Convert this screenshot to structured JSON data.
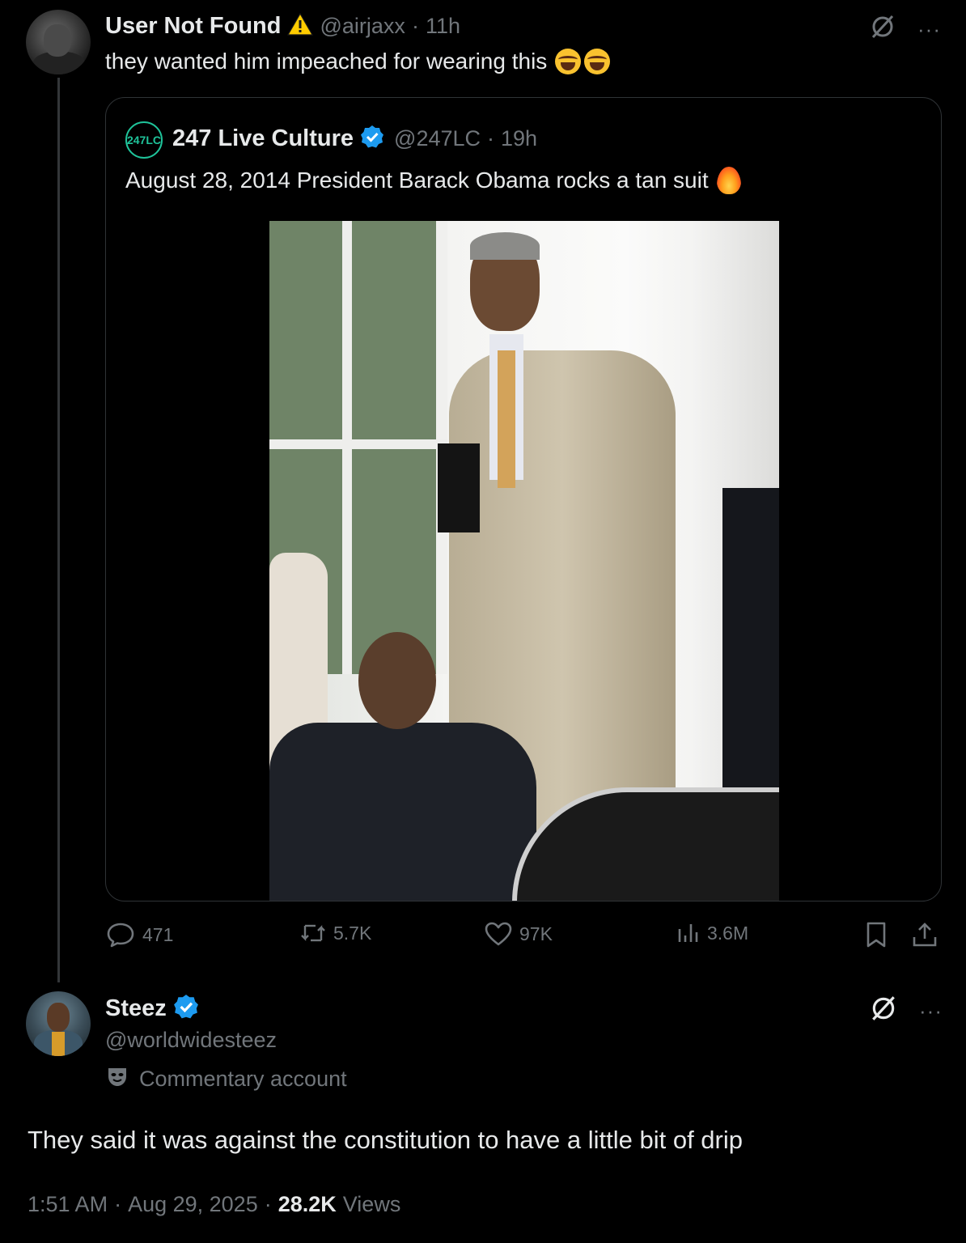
{
  "original_post": {
    "display_name": "User Not Found",
    "handle": "@airjaxx",
    "separator": "·",
    "time": "11h",
    "text": "they wanted him impeached for wearing this",
    "emojis": [
      "face-with-tears-of-joy",
      "face-with-tears-of-joy"
    ],
    "more_label": "···"
  },
  "quoted_post": {
    "logo_text": "247LC",
    "display_name": "247 Live Culture",
    "handle": "@247LC",
    "separator": "·",
    "time": "19h",
    "text": "August 28, 2014 President Barack Obama rocks a tan suit",
    "emoji": "fire"
  },
  "actions": {
    "replies": "471",
    "reposts": "5.7K",
    "likes": "97K",
    "views": "3.6M"
  },
  "reply_post": {
    "display_name": "Steez",
    "handle": "@worldwidesteez",
    "label": "Commentary account",
    "text": "They said it was against the constitution to have a little bit of drip",
    "time": "1:51 AM",
    "date": "Aug 29, 2025",
    "separator": "·",
    "views_count": "28.2K",
    "views_label": "Views",
    "more_label": "···"
  },
  "colors": {
    "background": "#000000",
    "primary_text": "#e7e9ea",
    "secondary_text": "#71767b",
    "verified": "#1d9bf0",
    "border": "#2f3336",
    "logo_accent": "#1fc39a"
  }
}
